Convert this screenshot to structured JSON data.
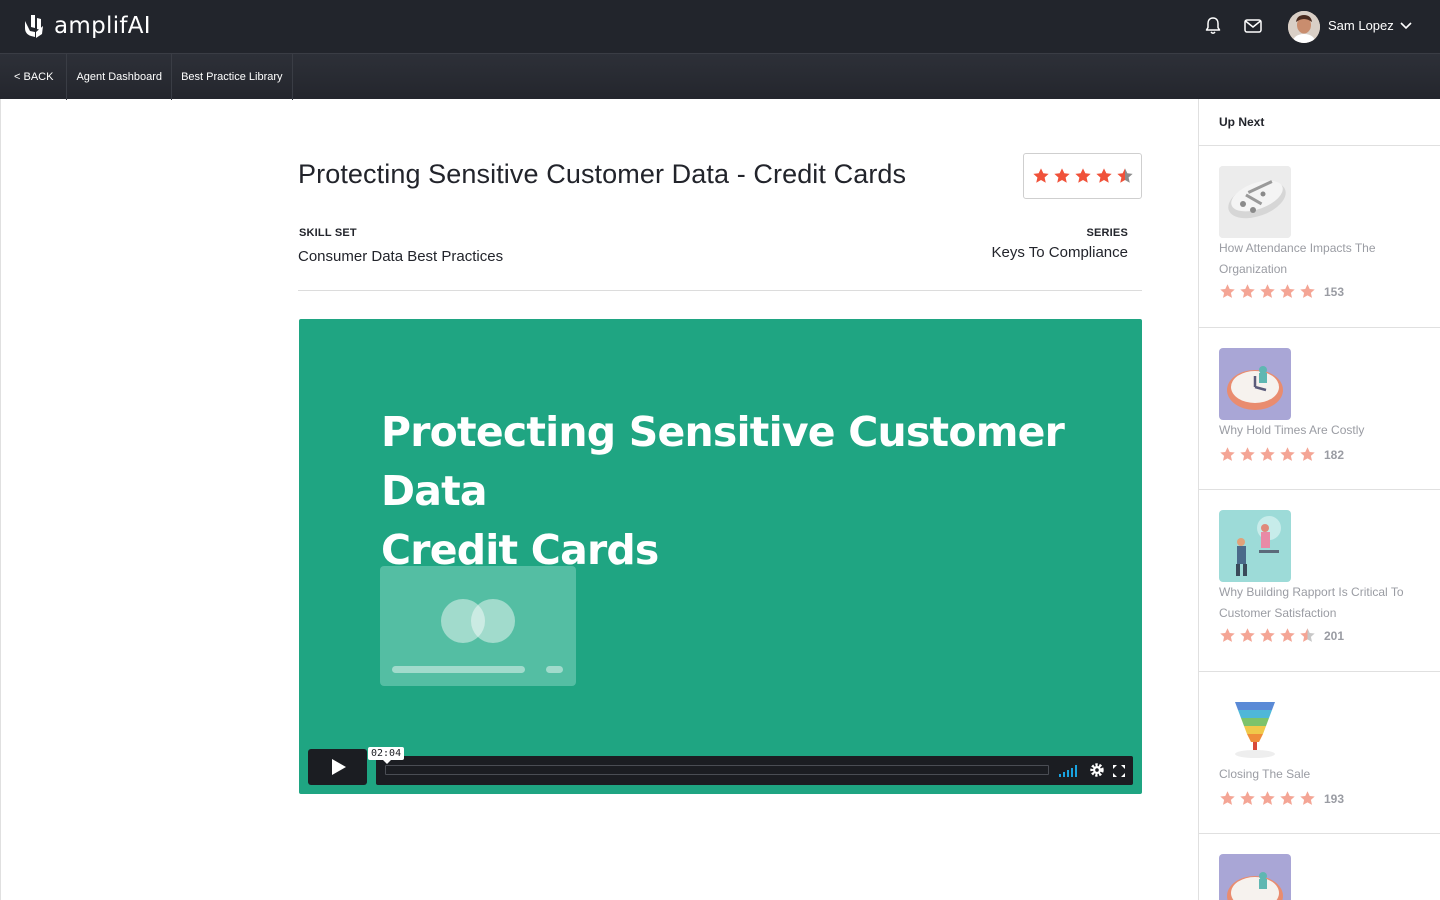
{
  "app": {
    "name": "amplifAI"
  },
  "user": {
    "name": "Sam Lopez"
  },
  "nav": {
    "back": "< BACK",
    "items": [
      "Agent Dashboard",
      "Best Practice Library"
    ]
  },
  "video": {
    "title": "Protecting Sensitive Customer Data - Credit Cards",
    "rating": 4.5,
    "skill_set_label": "SKILL SET",
    "skill_set": "Consumer Data Best Practices",
    "series_label": "SERIES",
    "series": "Keys To Compliance",
    "slide_title_line1": "Protecting Sensitive Customer Data",
    "slide_title_line2": "Credit Cards",
    "timecode": "02:04",
    "progress": 0
  },
  "sidebar": {
    "heading": "Up Next",
    "items": [
      {
        "title": "How Attendance Impacts The Organization",
        "rating": 5,
        "count": "153",
        "thumb": "clock-figures-thumb"
      },
      {
        "title": "Why Hold Times Are Costly",
        "rating": 5,
        "count": "182",
        "thumb": "clock-purple-thumb"
      },
      {
        "title": "Why Building Rapport Is Critical To Customer Satisfaction",
        "rating": 4.5,
        "count": "201",
        "thumb": "rapport-people-thumb"
      },
      {
        "title": "Closing The Sale",
        "rating": 5,
        "count": "193",
        "thumb": "funnel-thumb"
      }
    ]
  },
  "colors": {
    "accent": "#f0523a",
    "video_bg": "#1fa582",
    "topbar": "#22252c"
  }
}
